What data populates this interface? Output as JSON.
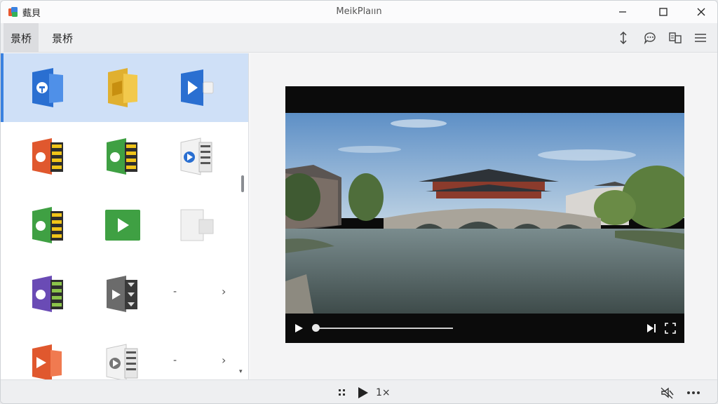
{
  "app": {
    "title": "薽貝",
    "caption": "MeikPlaıın"
  },
  "toolbar": {
    "tabs": [
      {
        "label": "景桥",
        "active": true
      },
      {
        "label": "景桥",
        "active": false
      }
    ],
    "icons": [
      "upload-icon",
      "chat-icon",
      "compare-icon",
      "menu-icon"
    ]
  },
  "grid": {
    "rows": [
      {
        "selected": true,
        "cells": [
          "blue-media-file-icon",
          "yellow-media-file-icon",
          "blue-play-file-icon"
        ]
      },
      {
        "selected": false,
        "cells": [
          "orange-archive-file-icon",
          "green-archive-file-icon",
          "white-play-archive-icon"
        ]
      },
      {
        "selected": false,
        "cells": [
          "green-archive-file-icon",
          "green-play-icon",
          "white-blank-file-icon"
        ]
      },
      {
        "selected": false,
        "cells": [
          "purple-archive-file-icon",
          "gray-play-archive-icon",
          "dash"
        ],
        "dash": "-",
        "chevron": "›"
      },
      {
        "selected": false,
        "cells": [
          "orange-play-file-icon",
          "white-play-archive-icon",
          "dash"
        ],
        "dash": "-",
        "chevron": "›"
      }
    ]
  },
  "player": {
    "progress": 0.0
  },
  "bottombar": {
    "speed": "1×"
  },
  "colors": {
    "accent": "#3b82e0",
    "selected_row": "#cfe0f7"
  }
}
